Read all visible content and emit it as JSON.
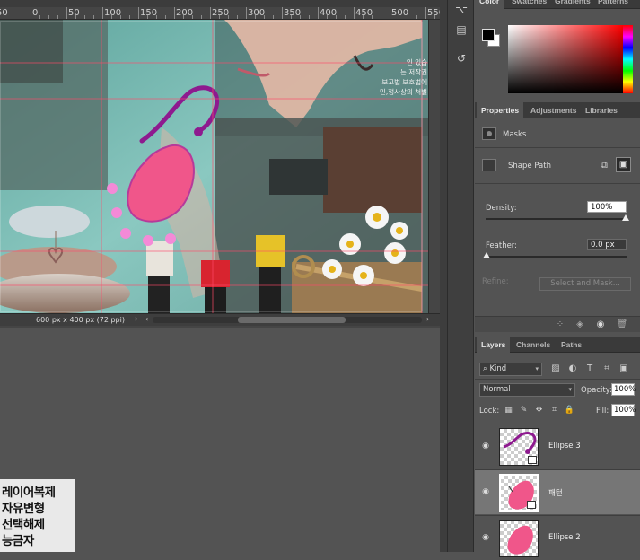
{
  "document": {
    "title": "",
    "status_info": "600 px x 400 px (72 ppi)",
    "ruler_labels": [
      "50",
      "0",
      "50",
      "100",
      "150",
      "200",
      "250",
      "300",
      "350",
      "400",
      "450",
      "500",
      "550"
    ],
    "canvas_text_lines": [
      "인 있습",
      "는 저작권",
      "보고법 보호법에",
      "민,형사상의 처벌"
    ]
  },
  "note": {
    "lines": [
      "레이어복제",
      "자유변형",
      "선택해제",
      "능금자"
    ]
  },
  "tools": {
    "icons": [
      "history-brush-icon",
      "comment-icon",
      "history-icon"
    ]
  },
  "color_panel": {
    "tabs": [
      "Color",
      "Swatches",
      "Gradients",
      "Patterns"
    ],
    "foreground": "#000000",
    "background": "#ffffff",
    "hue": "#ff0000"
  },
  "properties_panel": {
    "tabs": [
      "Properties",
      "Adjustments",
      "Libraries"
    ],
    "masks_label": "Masks",
    "shape_path_label": "Shape Path",
    "density_label": "Density:",
    "density_value": "100%",
    "feather_label": "Feather:",
    "feather_value": "0.0 px",
    "refine_label": "Refine:",
    "select_mask_label": "Select and Mask..."
  },
  "layers_panel": {
    "tabs": [
      "Layers",
      "Channels",
      "Paths"
    ],
    "kind_label": "Kind",
    "blend_mode": "Normal",
    "opacity_label": "Opacity:",
    "opacity_value": "100%",
    "lock_label": "Lock:",
    "fill_label": "Fill:",
    "fill_value": "100%",
    "layers": [
      {
        "name": "Ellipse 3",
        "selected": false
      },
      {
        "name": "패턴",
        "selected": true
      },
      {
        "name": "Ellipse 2",
        "selected": false
      }
    ]
  },
  "colors": {
    "accent_pink": "#f0568a",
    "accent_purple": "#8e1a8f",
    "panel_bg": "#535353",
    "workspace_bg": "#535353"
  }
}
